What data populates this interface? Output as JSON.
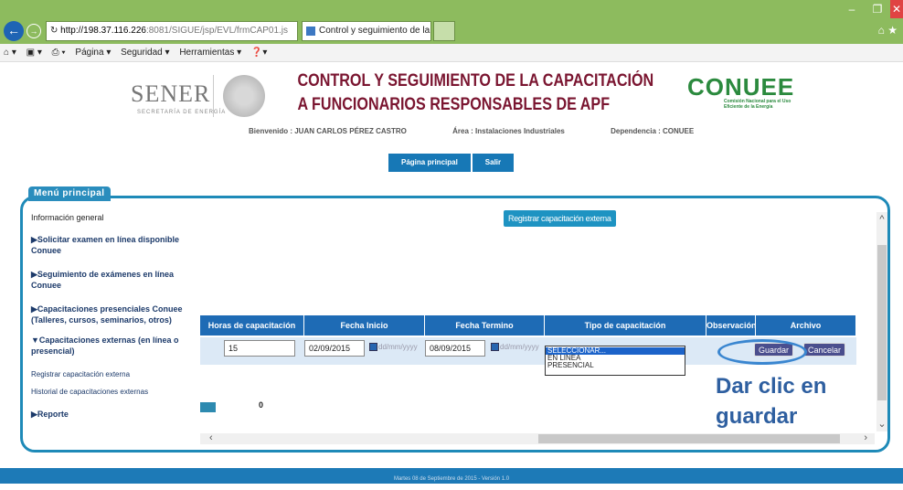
{
  "browser": {
    "url_host": "http://198.37.116.226",
    "url_rest": ":8081/SIGUE/jsp/EVL/frmCAP01.js",
    "tab_title": "Control y seguimiento de la...",
    "command_items": [
      "Página ▾",
      "Seguridad ▾",
      "Herramientas ▾"
    ]
  },
  "header": {
    "sener": "SENER",
    "sener_sub": "SECRETARÍA DE ENERGÍA",
    "title_line1": "CONTROL Y SEGUIMIENTO DE LA CAPACITACIÓN",
    "title_line2": "A FUNCIONARIOS RESPONSABLES DE APF",
    "conuee": "CONUEE",
    "conuee_sub": "Comisión Nacional para el Uso Eficiente de la Energía",
    "welcome": "Bienvenido : JUAN CARLOS PÉREZ CASTRO",
    "area": "Área : Instalaciones Industriales",
    "dependencia": "Dependencia : CONUEE",
    "btn_home": "Página principal",
    "btn_exit": "Salir"
  },
  "menu": {
    "tab_label": "Menú principal",
    "info": "Información general",
    "item1": "Solicitar examen en línea disponible Conuee",
    "item2": "Seguimiento de exámenes en línea Conuee",
    "item3": "Capacitaciones presenciales Conuee (Talleres, cursos, seminarios, otros)",
    "item4": "Capacitaciones externas (en línea o presencial)",
    "sub1": "Registrar capacitación externa",
    "sub2": "Historial de capacitaciones externas",
    "item5": "Reporte"
  },
  "main": {
    "register_btn": "Registrar capacitación externa",
    "columns": [
      "Horas de capacitación",
      "Fecha Inicio",
      "Fecha Termino",
      "Tipo de capacitación",
      "Observación",
      "Archivo"
    ],
    "hours": "15",
    "start_date": "02/09/2015",
    "end_date": "08/09/2015",
    "date_placeholder": "dd/mm/yyyy",
    "options": [
      "SELECCIONAR...",
      "EN LINEA",
      "PRESENCIAL"
    ],
    "save": "Guardar",
    "cancel": "Cancelar",
    "count": "0",
    "callout": "Dar clic en guardar"
  },
  "footer": {
    "text": "Martes 08 de Septiembre de 2015 - Versión 1.0"
  }
}
